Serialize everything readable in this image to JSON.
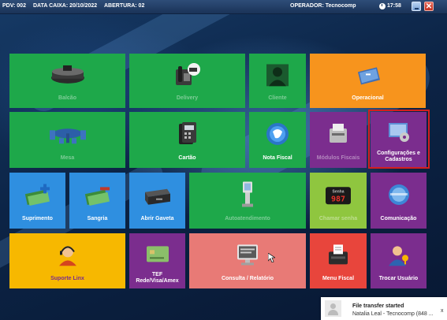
{
  "status_bar": {
    "pdv": "PDV: 002",
    "data_caixa": "DATA CAIXA: 20/10/2022",
    "abertura": "ABERTURA: 02",
    "operador": "OPERADOR: Tecnocomp",
    "hora": "17:58",
    "close_glyph": "✕"
  },
  "tiles": {
    "balcao": "Balcão",
    "delivery": "Delivery",
    "cliente": "Cliente",
    "operacional": "Operacional",
    "mesa": "Mesa",
    "cartao": "Cartão",
    "nota_fiscal": "Nota Fiscal",
    "modulos_fiscais": "Módulos Fiscais",
    "configuracoes": "Configurações e Cadastros",
    "suprimento": "Suprimento",
    "sangria": "Sangria",
    "abrir_gaveta": "Abrir Gaveta",
    "autoatendimento": "Autoatendimento",
    "chamar_senha": "Chamar senha",
    "comunicacao": "Comunicação",
    "suporte_linx": "Suporte Linx",
    "tef": "TEF Rede/Visa/Amex",
    "consulta": "Consulta / Relatório",
    "menu_fiscal": "Menu Fiscal",
    "trocar_usuario": "Trocar Usuário",
    "senha_display": "987",
    "senha_caption": "Senha"
  },
  "icons": {
    "balcao": "counter-icon",
    "delivery": "delivery-phone-icon",
    "cliente": "customer-icon",
    "operacional": "operations-icon",
    "mesa": "table-icon",
    "cartao": "card-icon",
    "nota_fiscal": "globe-icon",
    "modulos_fiscais": "fiscal-printer-icon",
    "configuracoes": "settings-icon",
    "suprimento": "cash-add-icon",
    "sangria": "cash-remove-icon",
    "abrir_gaveta": "cash-drawer-icon",
    "autoatendimento": "kiosk-icon",
    "chamar_senha": "queue-display-icon",
    "comunicacao": "communication-icon",
    "suporte_linx": "support-agent-icon",
    "tef": "payment-card-icon",
    "consulta": "report-monitor-icon",
    "menu_fiscal": "receipt-printer-icon",
    "trocar_usuario": "user-switch-icon"
  },
  "notification": {
    "title": "File transfer started",
    "subtitle": "Natalia Leal - Tecnocomp (848 ...",
    "close_glyph": "x"
  }
}
